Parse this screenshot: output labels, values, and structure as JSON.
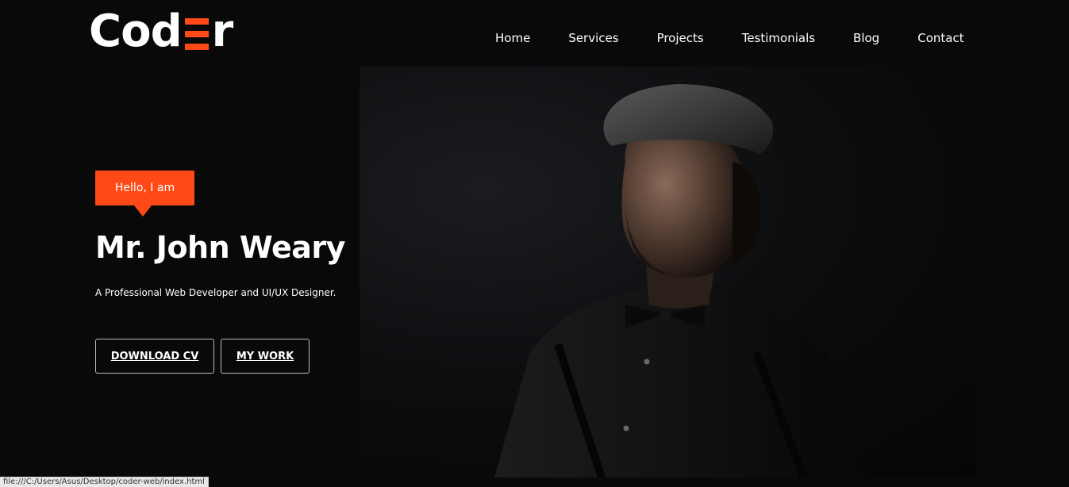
{
  "logo": {
    "text_before": "Cod",
    "text_after": "r",
    "accent_color": "#ff4a17"
  },
  "nav": {
    "items": [
      {
        "label": "Home"
      },
      {
        "label": "Services"
      },
      {
        "label": "Projects"
      },
      {
        "label": "Testimonials"
      },
      {
        "label": "Blog"
      },
      {
        "label": "Contact"
      }
    ]
  },
  "hero": {
    "badge": "Hello, I am",
    "name": "Mr. John Weary",
    "subtitle": "A Professional Web Developer and UI/UX Designer.",
    "buttons": {
      "download_cv": "DOWNLOAD CV",
      "my_work": "MY WORK"
    },
    "photo_subject": "man-in-flat-cap-and-bow-tie"
  },
  "statusbar": {
    "url": "file:///C:/Users/Asus/Desktop/coder-web/index.html"
  },
  "colors": {
    "background": "#0a0909",
    "accent": "#ff4a17",
    "text": "#ffffff"
  }
}
